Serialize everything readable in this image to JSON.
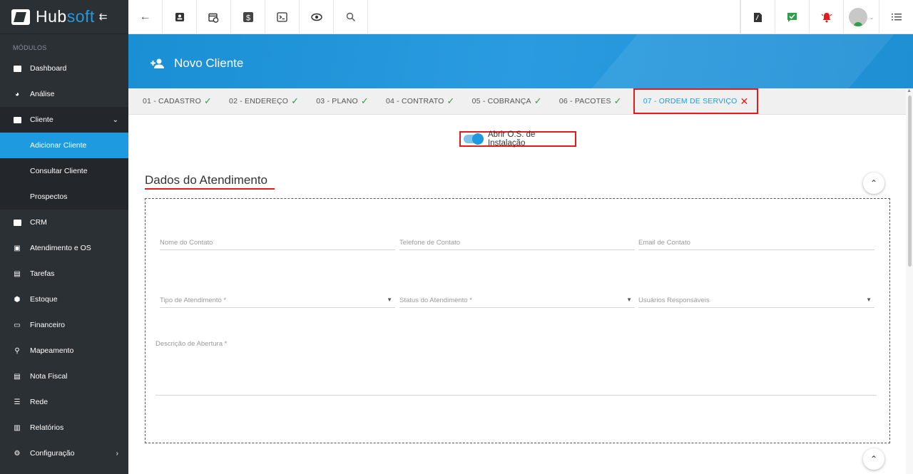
{
  "brand": {
    "hub": "Hub",
    "soft": "soft",
    "collapse_icon": "⇇"
  },
  "sidebar": {
    "modules_label": "MÓDULOS",
    "items": [
      {
        "label": "Dashboard"
      },
      {
        "label": "Análise"
      },
      {
        "label": "Cliente"
      },
      {
        "label": "CRM"
      },
      {
        "label": "Atendimento e OS"
      },
      {
        "label": "Tarefas"
      },
      {
        "label": "Estoque"
      },
      {
        "label": "Financeiro"
      },
      {
        "label": "Mapeamento"
      },
      {
        "label": "Nota Fiscal"
      },
      {
        "label": "Rede"
      },
      {
        "label": "Relatórios"
      },
      {
        "label": "Configuração"
      }
    ],
    "cliente_sub": [
      {
        "label": "Adicionar Cliente"
      },
      {
        "label": "Consultar Cliente"
      },
      {
        "label": "Prospectos"
      }
    ]
  },
  "header": {
    "title": "Novo Cliente"
  },
  "steps": [
    {
      "label": "01 - CADASTRO"
    },
    {
      "label": "02 - ENDEREÇO"
    },
    {
      "label": "03 - PLANO"
    },
    {
      "label": "04 - CONTRATO"
    },
    {
      "label": "05 - COBRANÇA"
    },
    {
      "label": "06 - PACOTES"
    },
    {
      "label": "07 - ORDEM DE SERVIÇO"
    }
  ],
  "toggle": {
    "label": "Abrir O.S. de Instalação",
    "checked": true
  },
  "section": {
    "title": "Dados do Atendimento"
  },
  "form": {
    "nome_contato": "Nome do Contato",
    "telefone_contato": "Telefone de Contato",
    "email_contato": "Email de Contato",
    "tipo_atendimento": "Tipo de Atendimento *",
    "status_atendimento": "Status do Atendimento *",
    "usuarios_responsaveis": "Usuários Responsáveis",
    "descricao_abertura": "Descrição de Abertura *"
  },
  "colors": {
    "accent": "#1e9be0",
    "highlight": "#e31b1b",
    "success": "#2e9e4a",
    "sidebar": "#2b3035"
  }
}
